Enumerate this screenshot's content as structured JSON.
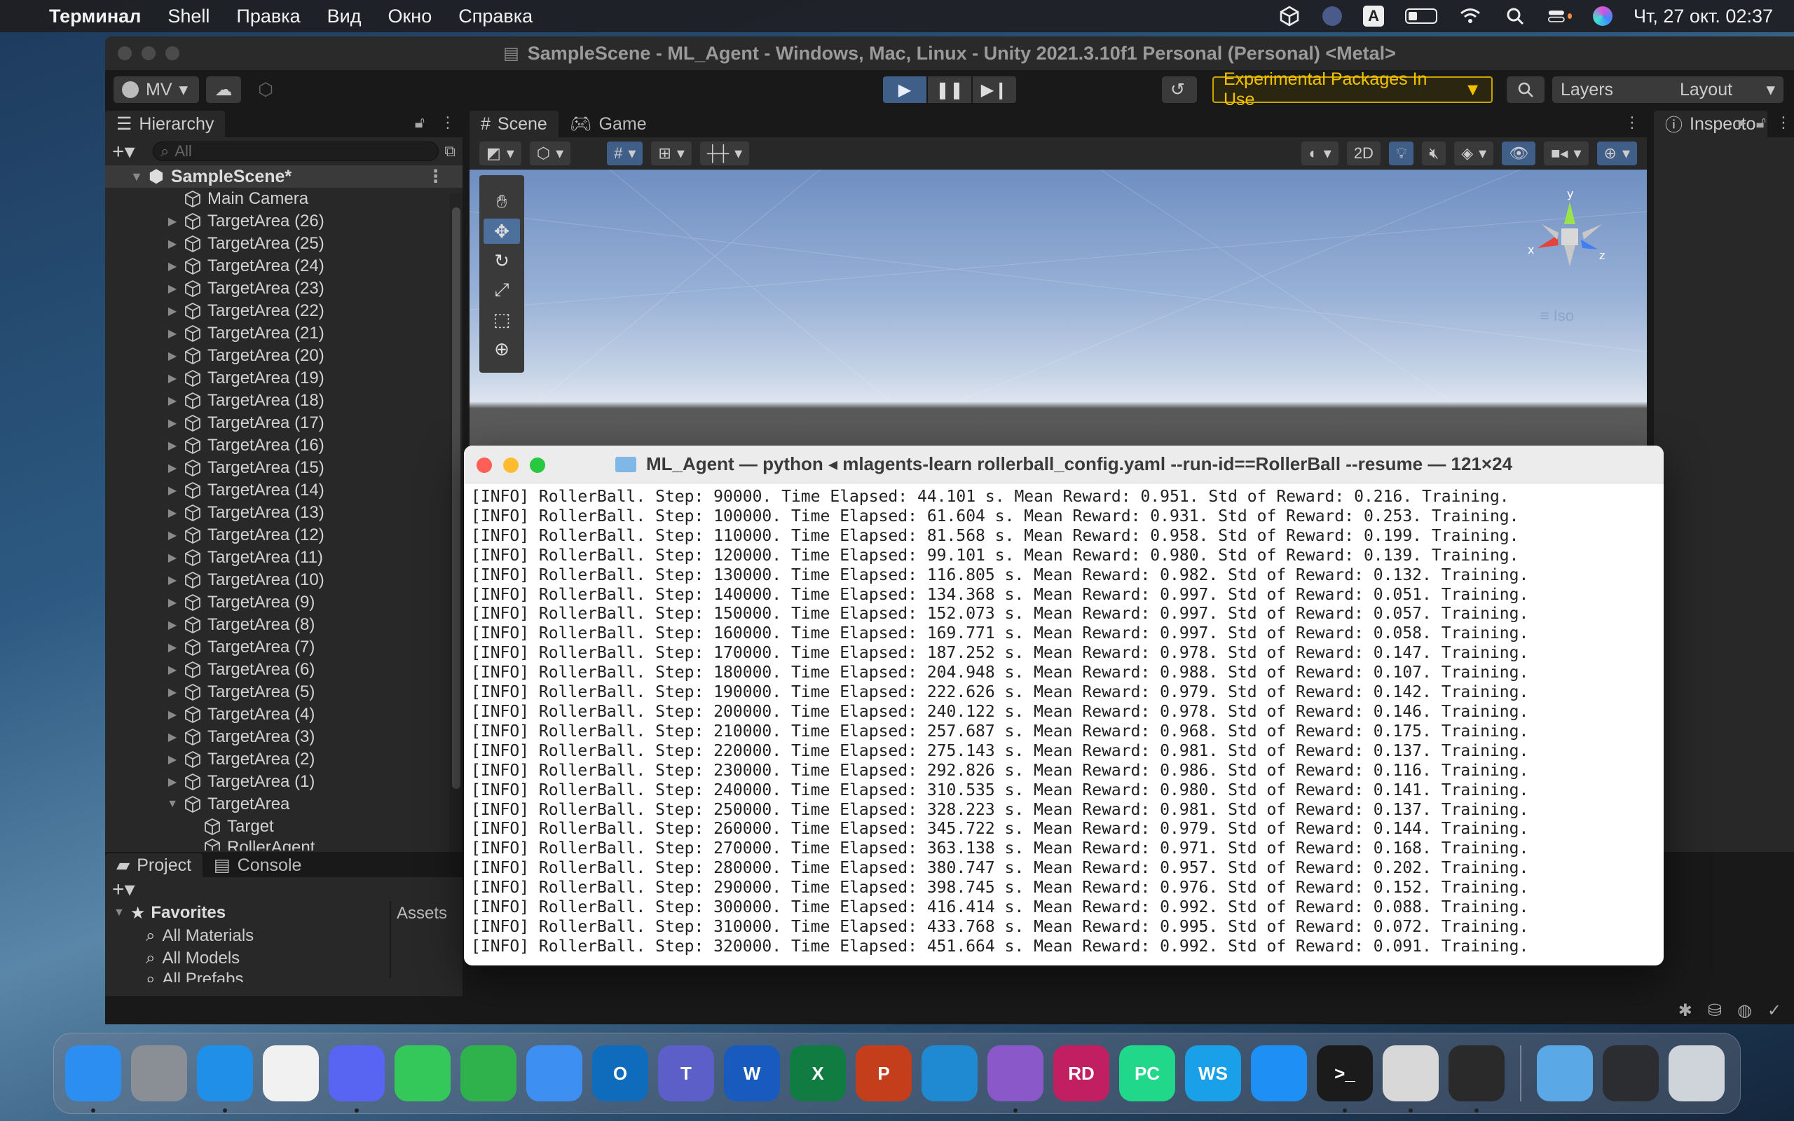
{
  "menubar": {
    "apple_icon": "apple-icon",
    "app_name": "Терминал",
    "items": [
      "Shell",
      "Правка",
      "Вид",
      "Окно",
      "Справка"
    ],
    "clock": "Чт, 27 окт.  02:37",
    "input_source": "A"
  },
  "unity": {
    "title": "SampleScene - ML_Agent - Windows, Mac, Linux - Unity 2021.3.10f1 Personal (Personal) <Metal>",
    "account_label": "MV",
    "experimental_label": "Experimental Packages In Use",
    "layers_label": "Layers",
    "layout_label": "Layout",
    "hierarchy": {
      "tab_label": "Hierarchy",
      "search_placeholder": "All",
      "scene_name": "SampleScene*",
      "items": [
        {
          "label": "Main Camera",
          "expandable": false,
          "indent": 0
        },
        {
          "label": "TargetArea (26)",
          "expandable": true,
          "indent": 0
        },
        {
          "label": "TargetArea (25)",
          "expandable": true,
          "indent": 0
        },
        {
          "label": "TargetArea (24)",
          "expandable": true,
          "indent": 0
        },
        {
          "label": "TargetArea (23)",
          "expandable": true,
          "indent": 0
        },
        {
          "label": "TargetArea (22)",
          "expandable": true,
          "indent": 0
        },
        {
          "label": "TargetArea (21)",
          "expandable": true,
          "indent": 0
        },
        {
          "label": "TargetArea (20)",
          "expandable": true,
          "indent": 0
        },
        {
          "label": "TargetArea (19)",
          "expandable": true,
          "indent": 0
        },
        {
          "label": "TargetArea (18)",
          "expandable": true,
          "indent": 0
        },
        {
          "label": "TargetArea (17)",
          "expandable": true,
          "indent": 0
        },
        {
          "label": "TargetArea (16)",
          "expandable": true,
          "indent": 0
        },
        {
          "label": "TargetArea (15)",
          "expandable": true,
          "indent": 0
        },
        {
          "label": "TargetArea (14)",
          "expandable": true,
          "indent": 0
        },
        {
          "label": "TargetArea (13)",
          "expandable": true,
          "indent": 0
        },
        {
          "label": "TargetArea (12)",
          "expandable": true,
          "indent": 0
        },
        {
          "label": "TargetArea (11)",
          "expandable": true,
          "indent": 0
        },
        {
          "label": "TargetArea (10)",
          "expandable": true,
          "indent": 0
        },
        {
          "label": "TargetArea (9)",
          "expandable": true,
          "indent": 0
        },
        {
          "label": "TargetArea (8)",
          "expandable": true,
          "indent": 0
        },
        {
          "label": "TargetArea (7)",
          "expandable": true,
          "indent": 0
        },
        {
          "label": "TargetArea (6)",
          "expandable": true,
          "indent": 0
        },
        {
          "label": "TargetArea (5)",
          "expandable": true,
          "indent": 0
        },
        {
          "label": "TargetArea (4)",
          "expandable": true,
          "indent": 0
        },
        {
          "label": "TargetArea (3)",
          "expandable": true,
          "indent": 0
        },
        {
          "label": "TargetArea (2)",
          "expandable": true,
          "indent": 0
        },
        {
          "label": "TargetArea (1)",
          "expandable": true,
          "indent": 0
        },
        {
          "label": "TargetArea",
          "expandable": true,
          "expanded": true,
          "indent": 0
        },
        {
          "label": "Target",
          "expandable": false,
          "indent": 1
        },
        {
          "label": "RollerAgent",
          "expandable": false,
          "indent": 1
        }
      ]
    },
    "scene_tabs": [
      "Scene",
      "Game"
    ],
    "scene_2d_label": "2D",
    "gizmo_axes": {
      "y": "y",
      "x": "x",
      "z": "z"
    },
    "persp_label": "Iso",
    "inspector_tab": "Inspecto",
    "project": {
      "tabs": [
        "Project",
        "Console"
      ],
      "favorites_label": "Favorites",
      "favorites": [
        "All Materials",
        "All Models",
        "All Prefabs"
      ],
      "assets_label": "Assets"
    }
  },
  "terminal": {
    "title": "ML_Agent — python ◂ mlagents-learn rollerball_config.yaml --run-id==RollerBall --resume — 121×24",
    "lines": [
      "[INFO] RollerBall. Step: 90000. Time Elapsed: 44.101 s. Mean Reward: 0.951. Std of Reward: 0.216. Training.",
      "[INFO] RollerBall. Step: 100000. Time Elapsed: 61.604 s. Mean Reward: 0.931. Std of Reward: 0.253. Training.",
      "[INFO] RollerBall. Step: 110000. Time Elapsed: 81.568 s. Mean Reward: 0.958. Std of Reward: 0.199. Training.",
      "[INFO] RollerBall. Step: 120000. Time Elapsed: 99.101 s. Mean Reward: 0.980. Std of Reward: 0.139. Training.",
      "[INFO] RollerBall. Step: 130000. Time Elapsed: 116.805 s. Mean Reward: 0.982. Std of Reward: 0.132. Training.",
      "[INFO] RollerBall. Step: 140000. Time Elapsed: 134.368 s. Mean Reward: 0.997. Std of Reward: 0.051. Training.",
      "[INFO] RollerBall. Step: 150000. Time Elapsed: 152.073 s. Mean Reward: 0.997. Std of Reward: 0.057. Training.",
      "[INFO] RollerBall. Step: 160000. Time Elapsed: 169.771 s. Mean Reward: 0.997. Std of Reward: 0.058. Training.",
      "[INFO] RollerBall. Step: 170000. Time Elapsed: 187.252 s. Mean Reward: 0.978. Std of Reward: 0.147. Training.",
      "[INFO] RollerBall. Step: 180000. Time Elapsed: 204.948 s. Mean Reward: 0.988. Std of Reward: 0.107. Training.",
      "[INFO] RollerBall. Step: 190000. Time Elapsed: 222.626 s. Mean Reward: 0.979. Std of Reward: 0.142. Training.",
      "[INFO] RollerBall. Step: 200000. Time Elapsed: 240.122 s. Mean Reward: 0.978. Std of Reward: 0.146. Training.",
      "[INFO] RollerBall. Step: 210000. Time Elapsed: 257.687 s. Mean Reward: 0.968. Std of Reward: 0.175. Training.",
      "[INFO] RollerBall. Step: 220000. Time Elapsed: 275.143 s. Mean Reward: 0.981. Std of Reward: 0.137. Training.",
      "[INFO] RollerBall. Step: 230000. Time Elapsed: 292.826 s. Mean Reward: 0.986. Std of Reward: 0.116. Training.",
      "[INFO] RollerBall. Step: 240000. Time Elapsed: 310.535 s. Mean Reward: 0.980. Std of Reward: 0.141. Training.",
      "[INFO] RollerBall. Step: 250000. Time Elapsed: 328.223 s. Mean Reward: 0.981. Std of Reward: 0.137. Training.",
      "[INFO] RollerBall. Step: 260000. Time Elapsed: 345.722 s. Mean Reward: 0.979. Std of Reward: 0.144. Training.",
      "[INFO] RollerBall. Step: 270000. Time Elapsed: 363.138 s. Mean Reward: 0.971. Std of Reward: 0.168. Training.",
      "[INFO] RollerBall. Step: 280000. Time Elapsed: 380.747 s. Mean Reward: 0.957. Std of Reward: 0.202. Training.",
      "[INFO] RollerBall. Step: 290000. Time Elapsed: 398.745 s. Mean Reward: 0.976. Std of Reward: 0.152. Training.",
      "[INFO] RollerBall. Step: 300000. Time Elapsed: 416.414 s. Mean Reward: 0.992. Std of Reward: 0.088. Training.",
      "[INFO] RollerBall. Step: 310000. Time Elapsed: 433.768 s. Mean Reward: 0.995. Std of Reward: 0.072. Training.",
      "[INFO] RollerBall. Step: 320000. Time Elapsed: 451.664 s. Mean Reward: 0.992. Std of Reward: 0.091. Training."
    ]
  },
  "dock": {
    "apps": [
      {
        "name": "finder-icon",
        "text": "",
        "color": "#2c8ef0",
        "running": true
      },
      {
        "name": "system-preferences-icon",
        "text": "",
        "color": "#8a8f96",
        "running": false
      },
      {
        "name": "safari-icon",
        "text": "",
        "color": "#1f8fe8",
        "running": true
      },
      {
        "name": "chrome-icon",
        "text": "",
        "color": "#f1f1f1",
        "running": false
      },
      {
        "name": "discord-icon",
        "text": "",
        "color": "#5865f2",
        "running": true
      },
      {
        "name": "messages-icon",
        "text": "",
        "color": "#34c759",
        "running": false
      },
      {
        "name": "facetime-icon",
        "text": "",
        "color": "#2fb24c",
        "running": false
      },
      {
        "name": "mail-icon",
        "text": "",
        "color": "#3d8ff2",
        "running": false
      },
      {
        "name": "outlook-icon",
        "text": "O",
        "color": "#0f6cbd",
        "running": false
      },
      {
        "name": "teams-icon",
        "text": "T",
        "color": "#5b5fc7",
        "running": false
      },
      {
        "name": "word-icon",
        "text": "W",
        "color": "#185abd",
        "running": false
      },
      {
        "name": "excel-icon",
        "text": "X",
        "color": "#107c41",
        "running": false
      },
      {
        "name": "powerpoint-icon",
        "text": "P",
        "color": "#c43e1c",
        "running": false
      },
      {
        "name": "vscode-icon",
        "text": "",
        "color": "#1f8ad2",
        "running": false
      },
      {
        "name": "visual-studio-icon",
        "text": "",
        "color": "#8a58c8",
        "running": true
      },
      {
        "name": "rider-icon",
        "text": "RD",
        "color": "#c21f63",
        "running": false
      },
      {
        "name": "pycharm-icon",
        "text": "PC",
        "color": "#21d789",
        "running": false
      },
      {
        "name": "webstorm-icon",
        "text": "WS",
        "color": "#1aa0e8",
        "running": false
      },
      {
        "name": "app-store-icon",
        "text": "",
        "color": "#1e90f5",
        "running": false
      },
      {
        "name": "terminal-icon",
        "text": ">_",
        "color": "#1b1b1b",
        "running": true
      },
      {
        "name": "unity-hub-icon",
        "text": "",
        "color": "#d8d8d8",
        "running": true
      },
      {
        "name": "unity-icon",
        "text": "",
        "color": "#2a2a2a",
        "running": true
      }
    ],
    "right_apps": [
      {
        "name": "downloads-folder-icon",
        "color": "#5aa8e6"
      },
      {
        "name": "discord-window-icon",
        "color": "#2b2d31"
      },
      {
        "name": "trash-icon",
        "color": "#cfd4da"
      }
    ]
  }
}
